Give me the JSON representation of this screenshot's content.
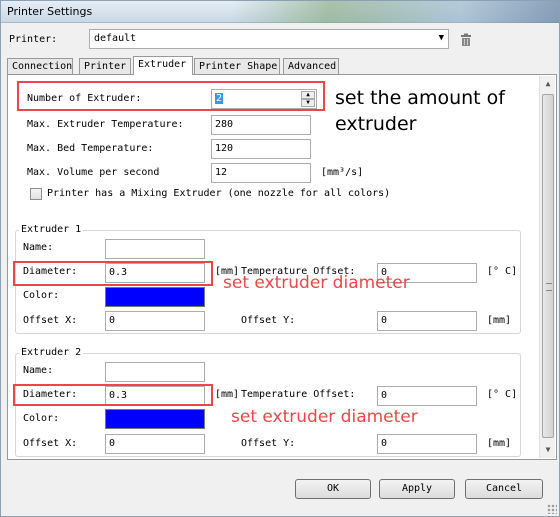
{
  "window": {
    "title": "Printer Settings"
  },
  "printer": {
    "label": "Printer:",
    "value": "default"
  },
  "tabs": [
    {
      "label": "Connection",
      "active": false
    },
    {
      "label": "Printer",
      "active": false
    },
    {
      "label": "Extruder",
      "active": true
    },
    {
      "label": "Printer Shape",
      "active": false
    },
    {
      "label": "Advanced",
      "active": false
    }
  ],
  "general": {
    "num_extruders_label": "Number of Extruder:",
    "num_extruders_value": "2",
    "max_ext_temp_label": "Max. Extruder Temperature:",
    "max_ext_temp_value": "280",
    "max_bed_temp_label": "Max. Bed Temperature:",
    "max_bed_temp_value": "120",
    "max_volume_label": "Max. Volume per second",
    "max_volume_value": "12",
    "max_volume_unit": "[mm³/s]",
    "mixing_label": "Printer has a Mixing Extruder (one nozzle for all colors)"
  },
  "extruder1": {
    "title": "Extruder 1",
    "name_label": "Name:",
    "name_value": "",
    "diameter_label": "Diameter:",
    "diameter_value": "0.3",
    "diameter_unit": "[mm]",
    "temp_offset_label": "Temperature Offset:",
    "temp_offset_value": "0",
    "temp_unit": "[° C]",
    "color_label": "Color:",
    "color": "#0000ff",
    "offset_x_label": "Offset X:",
    "offset_x_value": "0",
    "offset_y_label": "Offset Y:",
    "offset_y_value": "0",
    "offset_unit": "[mm]"
  },
  "extruder2": {
    "title": "Extruder 2",
    "name_label": "Name:",
    "name_value": "",
    "diameter_label": "Diameter:",
    "diameter_value": "0.3",
    "diameter_unit": "[mm]",
    "temp_offset_label": "Temperature Offset:",
    "temp_offset_value": "0",
    "temp_unit": "[° C]",
    "color_label": "Color:",
    "color": "#0000ff",
    "offset_x_label": "Offset X:",
    "offset_x_value": "0",
    "offset_y_label": "Offset Y:",
    "offset_y_value": "0",
    "offset_unit": "[mm]"
  },
  "annotations": {
    "amount_line1": "set the amount of",
    "amount_line2": "extruder",
    "diameter1": "set extruder diameter",
    "diameter2": "set extruder diameter",
    "amount_color": "#000000",
    "diameter_color": "#e8484a",
    "box_color": "#e8484a"
  },
  "buttons": {
    "ok": "OK",
    "apply": "Apply",
    "cancel": "Cancel"
  }
}
